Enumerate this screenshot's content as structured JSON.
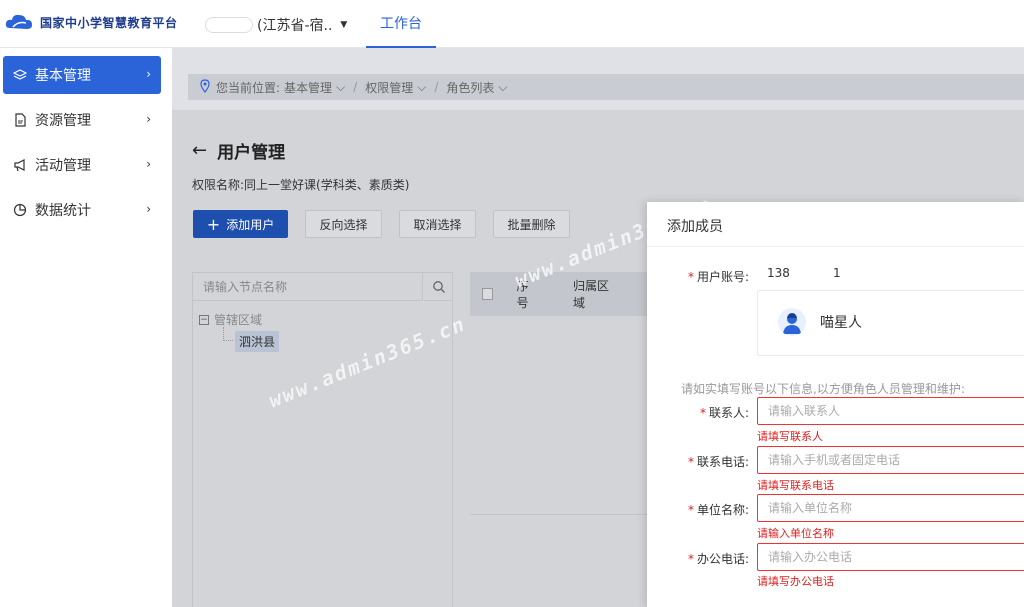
{
  "header": {
    "logo_text": "国家中小学智慧教育平台",
    "org_region": "(江苏省-宿..",
    "nav_tab": "工作台"
  },
  "sidebar": {
    "items": [
      {
        "label": "基本管理",
        "icon": "layers-icon",
        "active": true
      },
      {
        "label": "资源管理",
        "icon": "file-icon",
        "active": false
      },
      {
        "label": "活动管理",
        "icon": "megaphone-icon",
        "active": false
      },
      {
        "label": "数据统计",
        "icon": "pie-chart-icon",
        "active": false
      }
    ]
  },
  "breadcrumb": {
    "prefix": "您当前位置:",
    "items": [
      "基本管理",
      "权限管理",
      "角色列表"
    ]
  },
  "page": {
    "title": "用户管理",
    "permission": "权限名称:同上一堂好课(学科类、素质类)",
    "buttons": {
      "add_user": "添加用户",
      "reverse_select": "反向选择",
      "cancel_select": "取消选择",
      "batch_delete": "批量删除"
    }
  },
  "tree": {
    "search_placeholder": "请输入节点名称",
    "root": "管辖区域",
    "child": "泗洪县"
  },
  "table": {
    "columns": [
      "序号",
      "归属区域"
    ]
  },
  "watermark": {
    "text1": "www.admin365.cn",
    "text2": "www.admin365.cn"
  },
  "dialog": {
    "title": "添加成员",
    "account_label": "用户账号:",
    "account_value_a": "138",
    "account_value_b": "1",
    "user_name": "喵星人",
    "hint": "请如实填写账号以下信息,以方便角色人员管理和维护:",
    "fields": [
      {
        "label": "联系人:",
        "placeholder": "请输入联系人",
        "error": "请填写联系人"
      },
      {
        "label": "联系电话:",
        "placeholder": "请输入手机或者固定电话",
        "error": "请填写联系电话"
      },
      {
        "label": "单位名称:",
        "placeholder": "请输入单位名称",
        "error": "请输入单位名称"
      },
      {
        "label": "办公电话:",
        "placeholder": "请输入办公电话",
        "error": "请填写办公电话"
      }
    ]
  }
}
